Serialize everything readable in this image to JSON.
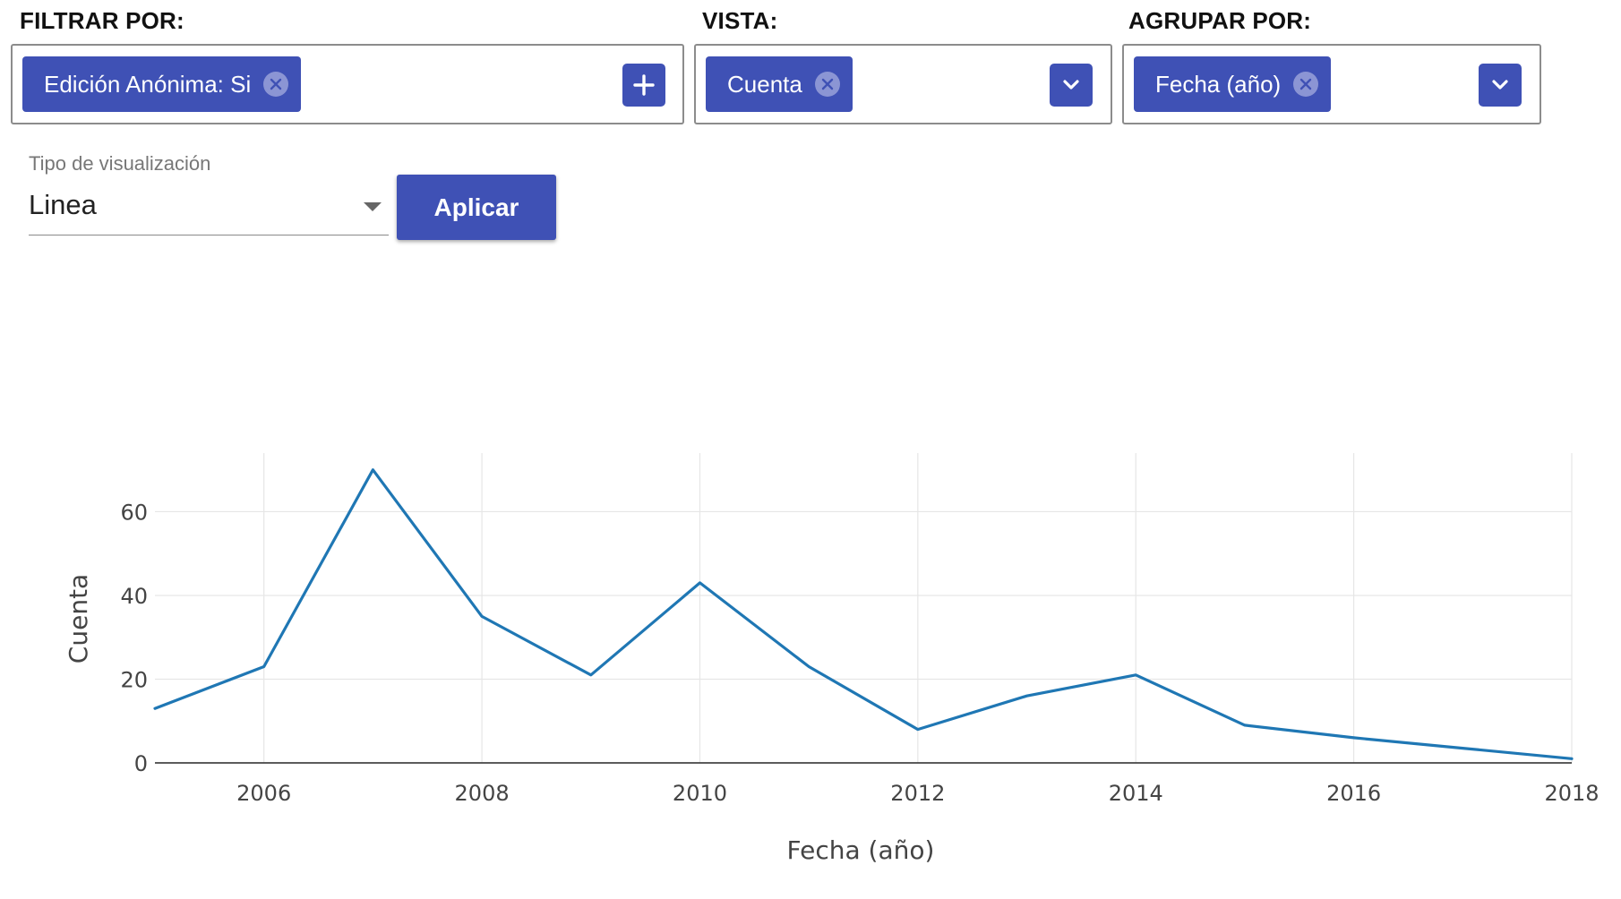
{
  "filters": {
    "filtrar": {
      "label": "FILTRAR POR:",
      "chips": [
        {
          "text": "Edición Anónima: Si"
        }
      ],
      "action_icon": "plus-icon"
    },
    "vista": {
      "label": "VISTA:",
      "chips": [
        {
          "text": "Cuenta"
        }
      ],
      "action_icon": "chevron-down-icon"
    },
    "agrupar": {
      "label": "AGRUPAR POR:",
      "chips": [
        {
          "text": "Fecha (año)"
        }
      ],
      "action_icon": "chevron-down-icon"
    }
  },
  "visualization": {
    "label": "Tipo de visualización",
    "value": "Linea",
    "apply_label": "Aplicar"
  },
  "colors": {
    "accent": "#3f51b5",
    "line": "#1f77b4",
    "grid": "#e6e6e6",
    "chip_close": "#8b95d4"
  },
  "chart_data": {
    "type": "line",
    "title": "",
    "xlabel": "Fecha (año)",
    "ylabel": "Cuenta",
    "x": [
      2005,
      2006,
      2007,
      2008,
      2009,
      2010,
      2011,
      2012,
      2013,
      2014,
      2015,
      2016,
      2017,
      2018
    ],
    "series": [
      {
        "values": [
          13,
          23,
          70,
          35,
          21,
          43,
          23,
          8,
          16,
          21,
          9,
          6,
          3.5,
          1
        ]
      }
    ],
    "xlim": [
      2005,
      2018
    ],
    "ylim": [
      0,
      74
    ],
    "xticks": [
      2006,
      2008,
      2010,
      2012,
      2014,
      2016,
      2018
    ],
    "yticks": [
      0,
      20,
      40,
      60
    ],
    "grid": true,
    "legend": "none"
  }
}
